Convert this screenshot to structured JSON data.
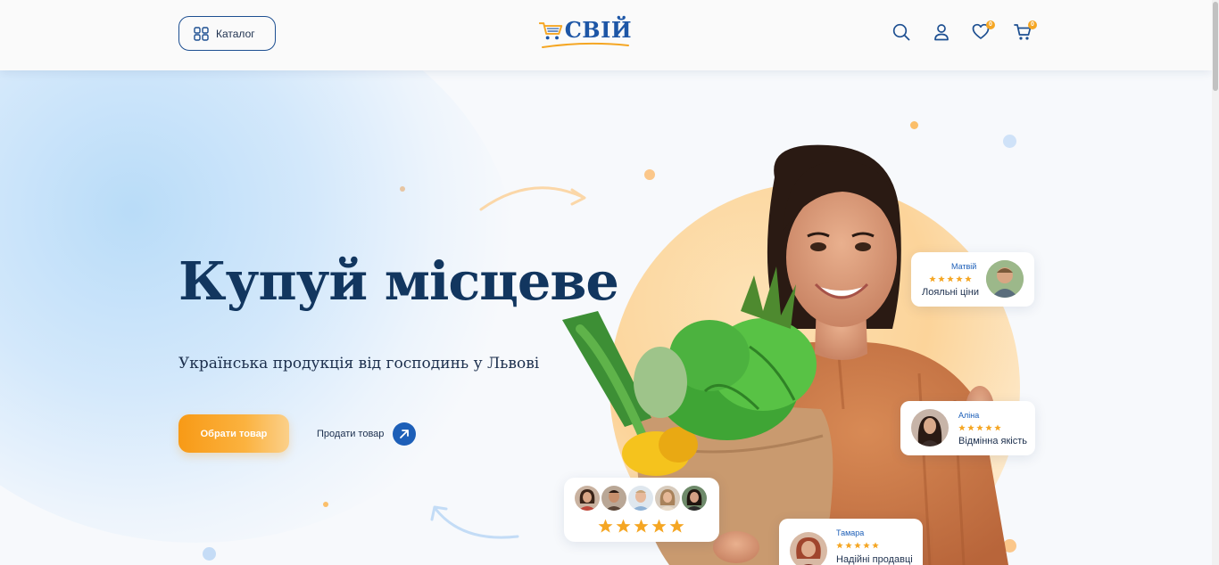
{
  "header": {
    "catalog_label": "Каталог",
    "logo_text": "СВІЙ",
    "wishlist_count": "0",
    "cart_count": "0",
    "icons": [
      "grid-icon",
      "shopping-cart-logo-icon",
      "search-icon",
      "user-icon",
      "heart-icon",
      "cart-icon"
    ]
  },
  "hero": {
    "headline": "Купуй місцеве",
    "subtitle": "Українська продукція від господинь у Львові",
    "cta_label": "Обрати товар",
    "sell_label": "Продати товар",
    "reviews": [
      {
        "name": "Матвій",
        "text": "Лояльні ціни",
        "rating": 5
      },
      {
        "name": "Аліна",
        "text": "Відмінна якість",
        "rating": 5
      },
      {
        "name": "Тамара",
        "text": "Надійні продавці",
        "rating": 5
      }
    ],
    "group_rating": 5,
    "group_avatars_count": 5
  },
  "colors": {
    "brand_blue": "#1d56a6",
    "headline_navy": "#12365f",
    "accent_orange": "#f89a16",
    "star_orange": "#f5a623"
  }
}
